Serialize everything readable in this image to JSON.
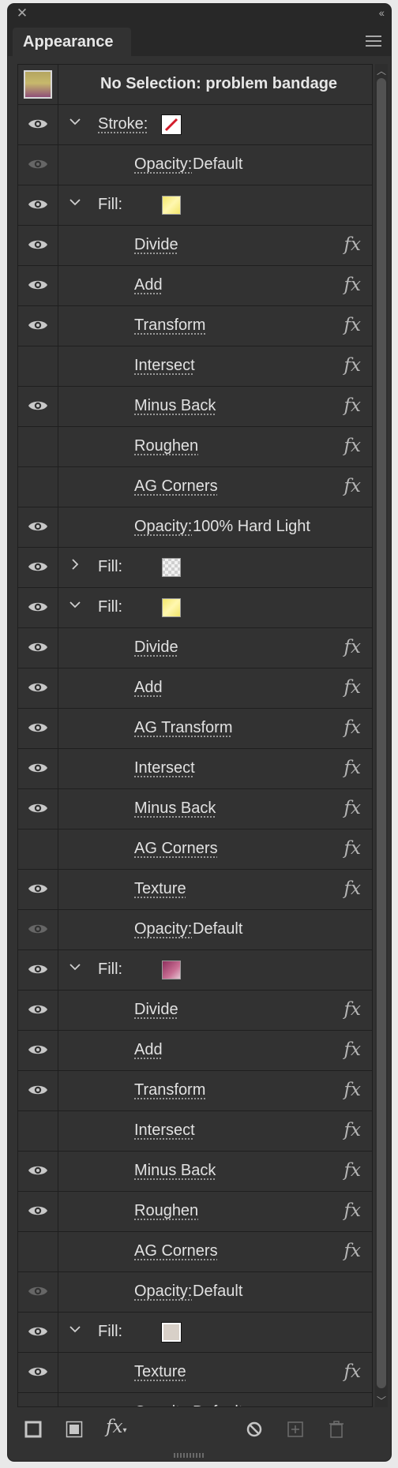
{
  "panel": {
    "title": "Appearance"
  },
  "header": {
    "title": "No Selection: problem bandage"
  },
  "rows": [
    {
      "type": "attr",
      "label": "Stroke:",
      "eye": true,
      "expanded": true,
      "swatch": "stroke-none",
      "selected": true
    },
    {
      "type": "opacity",
      "label": "Opacity:",
      "value": "Default",
      "eye": "dim"
    },
    {
      "type": "attr",
      "label": "Fill:",
      "eye": true,
      "expanded": true,
      "swatch": "yellow"
    },
    {
      "type": "effect",
      "label": "Divide",
      "eye": true
    },
    {
      "type": "effect",
      "label": "Add",
      "eye": true
    },
    {
      "type": "effect",
      "label": "Transform",
      "eye": true
    },
    {
      "type": "effect",
      "label": "Intersect",
      "eye": false
    },
    {
      "type": "effect",
      "label": "Minus Back",
      "eye": true
    },
    {
      "type": "effect",
      "label": "Roughen",
      "eye": false
    },
    {
      "type": "effect",
      "label": "AG Corners",
      "eye": false
    },
    {
      "type": "opacity",
      "label": "Opacity:",
      "value": "100% Hard Light",
      "eye": true
    },
    {
      "type": "attr",
      "label": "Fill:",
      "eye": true,
      "expanded": false,
      "swatch": "grey"
    },
    {
      "type": "attr",
      "label": "Fill:",
      "eye": true,
      "expanded": true,
      "swatch": "yellow"
    },
    {
      "type": "effect",
      "label": "Divide",
      "eye": true
    },
    {
      "type": "effect",
      "label": "Add",
      "eye": true
    },
    {
      "type": "effect",
      "label": "AG Transform",
      "eye": true
    },
    {
      "type": "effect",
      "label": "Intersect",
      "eye": true
    },
    {
      "type": "effect",
      "label": "Minus Back",
      "eye": true
    },
    {
      "type": "effect",
      "label": "AG Corners",
      "eye": false
    },
    {
      "type": "effect",
      "label": "Texture",
      "eye": true
    },
    {
      "type": "opacity",
      "label": "Opacity:",
      "value": "Default",
      "eye": "dim"
    },
    {
      "type": "attr",
      "label": "Fill:",
      "eye": true,
      "expanded": true,
      "swatch": "magenta"
    },
    {
      "type": "effect",
      "label": "Divide",
      "eye": true
    },
    {
      "type": "effect",
      "label": "Add",
      "eye": true
    },
    {
      "type": "effect",
      "label": "Transform",
      "eye": true
    },
    {
      "type": "effect",
      "label": "Intersect",
      "eye": false
    },
    {
      "type": "effect",
      "label": "Minus Back",
      "eye": true
    },
    {
      "type": "effect",
      "label": "Roughen",
      "eye": true
    },
    {
      "type": "effect",
      "label": "AG Corners",
      "eye": false
    },
    {
      "type": "opacity",
      "label": "Opacity:",
      "value": "Default",
      "eye": "dim"
    },
    {
      "type": "attr",
      "label": "Fill:",
      "eye": true,
      "expanded": true,
      "swatch": "beige",
      "selected": true
    },
    {
      "type": "effect",
      "label": "Texture",
      "eye": true
    },
    {
      "type": "opacity",
      "label": "Opacity:",
      "value": "Default",
      "eye": "dim"
    }
  ],
  "fx_symbol": "fx",
  "colors": {
    "panel_bg": "#323232",
    "row_divider": "#1f1f1f",
    "text": "#e1e1e1",
    "swatch_yellow": "#f2e66a",
    "swatch_magenta": "#8e2f5d",
    "swatch_beige": "#d8d0c8",
    "swatch_grey": "#cfcfcf"
  },
  "icons": {
    "close": "close-icon",
    "collapse": "double-chevron-left-icon",
    "menu": "hamburger-menu-icon",
    "eye": "eye-icon",
    "expand": "chevron-down-icon",
    "collapsed": "chevron-right-icon",
    "new_stroke": "add-new-stroke-icon",
    "new_fill": "add-new-fill-icon",
    "add_effect": "add-effect-icon",
    "clear": "clear-appearance-icon",
    "duplicate": "duplicate-item-icon",
    "delete": "delete-item-icon"
  }
}
